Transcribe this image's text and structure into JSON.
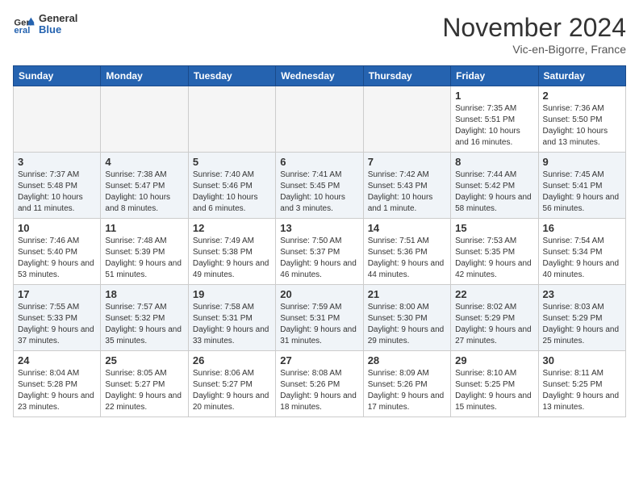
{
  "header": {
    "logo_general": "General",
    "logo_blue": "Blue",
    "month_title": "November 2024",
    "location": "Vic-en-Bigorre, France"
  },
  "days_of_week": [
    "Sunday",
    "Monday",
    "Tuesday",
    "Wednesday",
    "Thursday",
    "Friday",
    "Saturday"
  ],
  "weeks": [
    [
      {
        "day": "",
        "info": ""
      },
      {
        "day": "",
        "info": ""
      },
      {
        "day": "",
        "info": ""
      },
      {
        "day": "",
        "info": ""
      },
      {
        "day": "",
        "info": ""
      },
      {
        "day": "1",
        "info": "Sunrise: 7:35 AM\nSunset: 5:51 PM\nDaylight: 10 hours and 16 minutes."
      },
      {
        "day": "2",
        "info": "Sunrise: 7:36 AM\nSunset: 5:50 PM\nDaylight: 10 hours and 13 minutes."
      }
    ],
    [
      {
        "day": "3",
        "info": "Sunrise: 7:37 AM\nSunset: 5:48 PM\nDaylight: 10 hours and 11 minutes."
      },
      {
        "day": "4",
        "info": "Sunrise: 7:38 AM\nSunset: 5:47 PM\nDaylight: 10 hours and 8 minutes."
      },
      {
        "day": "5",
        "info": "Sunrise: 7:40 AM\nSunset: 5:46 PM\nDaylight: 10 hours and 6 minutes."
      },
      {
        "day": "6",
        "info": "Sunrise: 7:41 AM\nSunset: 5:45 PM\nDaylight: 10 hours and 3 minutes."
      },
      {
        "day": "7",
        "info": "Sunrise: 7:42 AM\nSunset: 5:43 PM\nDaylight: 10 hours and 1 minute."
      },
      {
        "day": "8",
        "info": "Sunrise: 7:44 AM\nSunset: 5:42 PM\nDaylight: 9 hours and 58 minutes."
      },
      {
        "day": "9",
        "info": "Sunrise: 7:45 AM\nSunset: 5:41 PM\nDaylight: 9 hours and 56 minutes."
      }
    ],
    [
      {
        "day": "10",
        "info": "Sunrise: 7:46 AM\nSunset: 5:40 PM\nDaylight: 9 hours and 53 minutes."
      },
      {
        "day": "11",
        "info": "Sunrise: 7:48 AM\nSunset: 5:39 PM\nDaylight: 9 hours and 51 minutes."
      },
      {
        "day": "12",
        "info": "Sunrise: 7:49 AM\nSunset: 5:38 PM\nDaylight: 9 hours and 49 minutes."
      },
      {
        "day": "13",
        "info": "Sunrise: 7:50 AM\nSunset: 5:37 PM\nDaylight: 9 hours and 46 minutes."
      },
      {
        "day": "14",
        "info": "Sunrise: 7:51 AM\nSunset: 5:36 PM\nDaylight: 9 hours and 44 minutes."
      },
      {
        "day": "15",
        "info": "Sunrise: 7:53 AM\nSunset: 5:35 PM\nDaylight: 9 hours and 42 minutes."
      },
      {
        "day": "16",
        "info": "Sunrise: 7:54 AM\nSunset: 5:34 PM\nDaylight: 9 hours and 40 minutes."
      }
    ],
    [
      {
        "day": "17",
        "info": "Sunrise: 7:55 AM\nSunset: 5:33 PM\nDaylight: 9 hours and 37 minutes."
      },
      {
        "day": "18",
        "info": "Sunrise: 7:57 AM\nSunset: 5:32 PM\nDaylight: 9 hours and 35 minutes."
      },
      {
        "day": "19",
        "info": "Sunrise: 7:58 AM\nSunset: 5:31 PM\nDaylight: 9 hours and 33 minutes."
      },
      {
        "day": "20",
        "info": "Sunrise: 7:59 AM\nSunset: 5:31 PM\nDaylight: 9 hours and 31 minutes."
      },
      {
        "day": "21",
        "info": "Sunrise: 8:00 AM\nSunset: 5:30 PM\nDaylight: 9 hours and 29 minutes."
      },
      {
        "day": "22",
        "info": "Sunrise: 8:02 AM\nSunset: 5:29 PM\nDaylight: 9 hours and 27 minutes."
      },
      {
        "day": "23",
        "info": "Sunrise: 8:03 AM\nSunset: 5:29 PM\nDaylight: 9 hours and 25 minutes."
      }
    ],
    [
      {
        "day": "24",
        "info": "Sunrise: 8:04 AM\nSunset: 5:28 PM\nDaylight: 9 hours and 23 minutes."
      },
      {
        "day": "25",
        "info": "Sunrise: 8:05 AM\nSunset: 5:27 PM\nDaylight: 9 hours and 22 minutes."
      },
      {
        "day": "26",
        "info": "Sunrise: 8:06 AM\nSunset: 5:27 PM\nDaylight: 9 hours and 20 minutes."
      },
      {
        "day": "27",
        "info": "Sunrise: 8:08 AM\nSunset: 5:26 PM\nDaylight: 9 hours and 18 minutes."
      },
      {
        "day": "28",
        "info": "Sunrise: 8:09 AM\nSunset: 5:26 PM\nDaylight: 9 hours and 17 minutes."
      },
      {
        "day": "29",
        "info": "Sunrise: 8:10 AM\nSunset: 5:25 PM\nDaylight: 9 hours and 15 minutes."
      },
      {
        "day": "30",
        "info": "Sunrise: 8:11 AM\nSunset: 5:25 PM\nDaylight: 9 hours and 13 minutes."
      }
    ]
  ]
}
